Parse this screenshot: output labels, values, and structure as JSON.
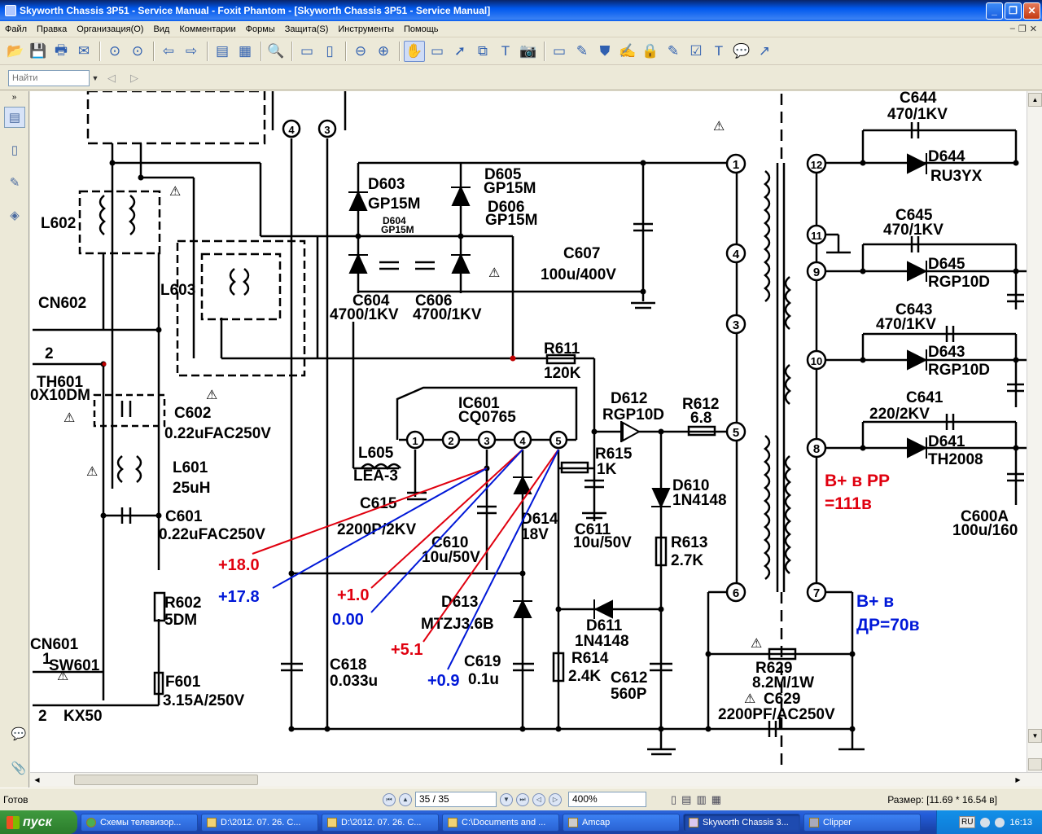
{
  "window": {
    "title": "Skyworth Chassis 3P51 - Service Manual - Foxit Phantom - [Skyworth Chassis 3P51 - Service Manual]",
    "minimize": "_",
    "maximize": "❐",
    "close": "✕"
  },
  "menu": [
    "Файл",
    "Правка",
    "Организация(O)",
    "Вид",
    "Комментарии",
    "Формы",
    "Защита(S)",
    "Инструменты",
    "Помощь"
  ],
  "find": {
    "placeholder": "Найти"
  },
  "status": {
    "ready": "Готов",
    "page": "35 / 35",
    "zoom": "400%",
    "size": "Размер: [11.69 * 16.54 в]"
  },
  "schematic": {
    "components": {
      "c644": "C644",
      "c644v": "470/1KV",
      "d644": "D644",
      "d644v": "RU3YX",
      "c645": "C645",
      "c645v": "470/1KV",
      "d645": "D645",
      "d645v": "RGP10D",
      "c643": "C643",
      "c643v": "470/1KV",
      "d643": "D643",
      "d643v": "RGP10D",
      "c641": "C641",
      "c641v": "220/2KV",
      "d641": "D641",
      "d641v": "TH2008",
      "c600a": "C600A",
      "c600av": "100u/160",
      "l602": "L602",
      "l603": "L603",
      "cn602": "CN602",
      "th601": "TH601",
      "th601v": "0X10DM",
      "two": "2",
      "c602": "C602",
      "c602v": "0.22uFAC250V",
      "l601": "L601",
      "l601v": "25uH",
      "c601": "C601",
      "c601v": "0.22uFAC250V",
      "r602": "R602",
      "r602v": "5DM",
      "cn601": "CN601",
      "sw601": "SW601",
      "kx50": "KX50",
      "one": "1",
      "f601": "F601",
      "f601v": "3.15A/250V",
      "d603": "D603",
      "d603v": "GP15M",
      "d604": "D604",
      "d604v": "GP15M",
      "d605": "D605",
      "d605v": "GP15M",
      "d606": "D606",
      "d606v": "GP15M",
      "c604": "C604",
      "c604v": "4700/1KV",
      "c606": "C606",
      "c606v": "4700/1KV",
      "c607": "C607",
      "c607v": "100u/400V",
      "r611": "R611",
      "r611v": "120K",
      "ic601": "IC601",
      "ic601v": "CQ0765",
      "l605": "L605",
      "l605v": "LEA-3",
      "c615": "C615",
      "c615v": "2200P/2KV",
      "c610": "C610",
      "c610v": "10u/50V",
      "d614": "D614",
      "d614v": "18V",
      "d613": "D613",
      "d613v": "MTZJ3.6B",
      "c618": "C618",
      "c618v": "0.033u",
      "c619": "C619",
      "c619v": "0.1u",
      "d612": "D612",
      "d612v": "RGP10D",
      "r612": "R612",
      "r612v": "6.8",
      "r615": "R615",
      "r615v": "1K",
      "c611": "C611",
      "c611v": "10u/50V",
      "d610": "D610",
      "d610v": "1N4148",
      "r613": "R613",
      "r613v": "2.7K",
      "d611": "D611",
      "d611v": "1N4148",
      "r614": "R614",
      "r614v": "2.4K",
      "c612": "C612",
      "c612v": "560P",
      "r629": "R629",
      "r629v": "8.2M/1W",
      "c629": "C629",
      "c629v": "2200PF/AC250V",
      "p1": "1",
      "p2": "2",
      "p3": "3",
      "p4": "4",
      "p5": "5",
      "t1": "1",
      "t3": "3",
      "t4": "4",
      "t5": "5",
      "t6": "6",
      "t7": "7",
      "t8": "8",
      "t9": "9",
      "t10": "10",
      "t11": "11",
      "t12": "12",
      "c4": "4",
      "c3": "3"
    },
    "annotations": {
      "bplus_pp": "В+ в РР",
      "bplus_pp_val": "=111в",
      "bplus_dr": "В+ в",
      "bplus_dr_val": "ДР=70в",
      "v1": "+18.0",
      "v2": "+17.8",
      "v3": "+1.0",
      "v4": "0.00",
      "v5": "+5.1",
      "v6": "+0.9"
    },
    "colors": {
      "red": "#e0000f",
      "blue": "#0018d8"
    }
  },
  "taskbar": {
    "start": "пуск",
    "tasks": [
      "Схемы телевизор...",
      "D:\\2012. 07. 26. С...",
      "D:\\2012. 07. 26. С...",
      "C:\\Documents and ...",
      "Amcap",
      "Skyworth Chassis 3...",
      "Clipper"
    ],
    "lang": "RU",
    "clock": "16:13"
  },
  "icons": [
    "open-icon",
    "save-icon",
    "print-icon",
    "email-icon",
    "hand-icon",
    "zoom-icon"
  ]
}
